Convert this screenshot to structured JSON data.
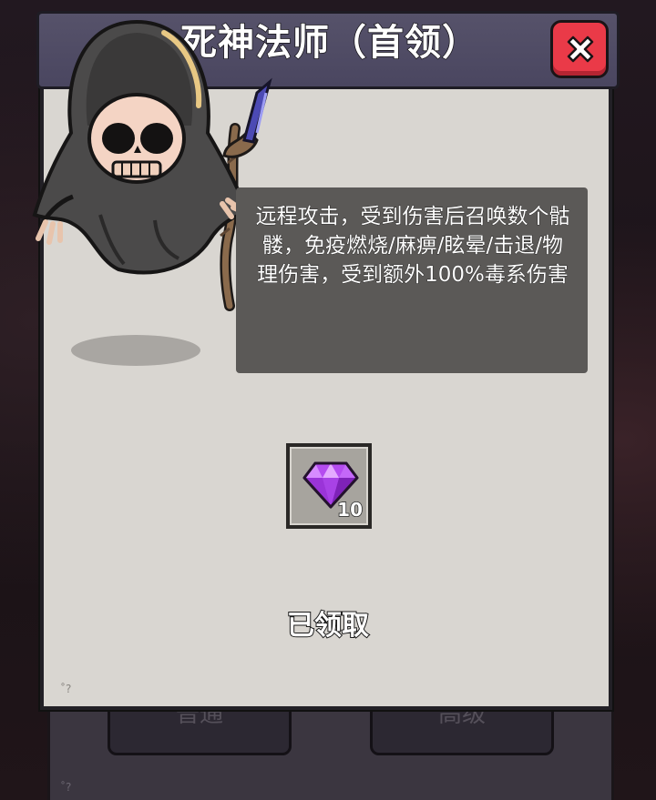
{
  "dialog": {
    "title": "死神法师（首领）",
    "description": "远程攻击，受到伤害后召唤数个骷髅，免疫燃烧/麻痹/眩晕/击退/物理伤害，受到额外100%毒系伤害",
    "close_icon": "close-x-icon"
  },
  "reward": {
    "icon": "purple-gem-icon",
    "count": "10"
  },
  "status": {
    "claimed_label": "已领取"
  },
  "background_tabs": {
    "left_label": "普通",
    "right_label": "高级"
  },
  "colors": {
    "close_button": "#ea3a48",
    "title_bar": "#4e4a64",
    "panel": "#d9d6d1",
    "gem": "#b54cf0"
  }
}
